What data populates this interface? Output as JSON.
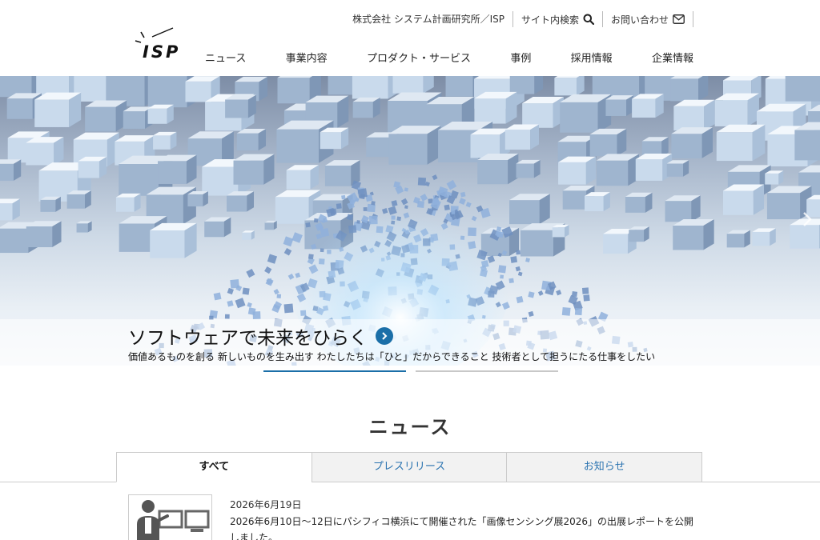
{
  "utility": {
    "company": "株式会社 システム計画研究所／ISP",
    "search_label": "サイト内検索",
    "contact_label": "お問い合わせ"
  },
  "logo": {
    "text": "ISP"
  },
  "nav": [
    "ニュース",
    "事業内容",
    "プロダクト・サービス",
    "事例",
    "採用情報",
    "企業情報"
  ],
  "hero": {
    "title": "ソフトウェアで未来をひらく",
    "subtitle": "価値あるものを創る 新しいものを生み出す わたしたちは「ひと」だからできること 技術者として担うにたる仕事をしたい",
    "slides_total": 2,
    "active_slide": 1
  },
  "news": {
    "heading": "ニュース",
    "tabs": [
      "すべて",
      "プレスリリース",
      "お知らせ"
    ],
    "active_tab": 0,
    "items": [
      {
        "date": "2026年6月19日",
        "text": "2026年6月10日〜12日にパシフィコ横浜にて開催された「画像センシング展2026」の出展レポートを公開しました。"
      }
    ]
  },
  "colors": {
    "accent": "#1b6fa8",
    "tab_link": "#2a73b0",
    "border": "#cccccc"
  }
}
